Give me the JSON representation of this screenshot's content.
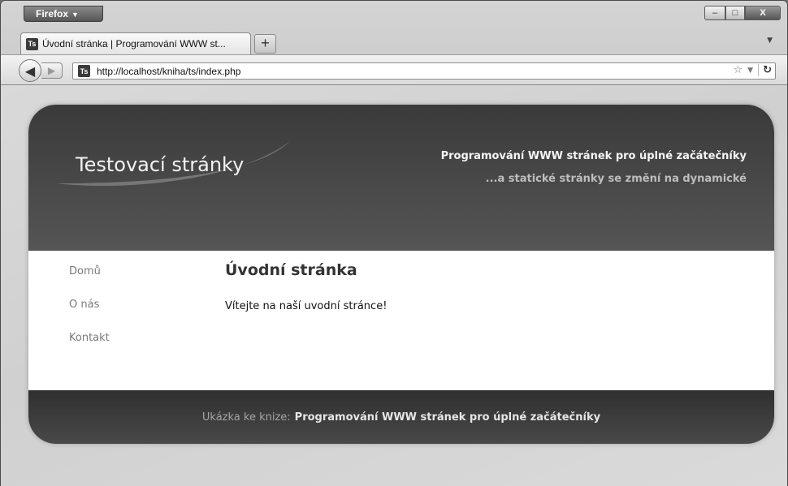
{
  "browser": {
    "menu_button": "Firefox",
    "window_controls": {
      "minimize": "–",
      "maximize": "□",
      "close": "X"
    },
    "tab": {
      "favicon": "Ts",
      "title": "Úvodní stránka | Programování WWW st..."
    },
    "new_tab": "+",
    "address": "http://localhost/kniha/ts/index.php",
    "icons": {
      "back": "arrow-left-icon",
      "forward": "arrow-right-icon",
      "bookmark": "star-icon",
      "dropdown": "chevron-down-icon",
      "reload": "reload-icon"
    }
  },
  "site": {
    "logo": "Testovací stránky",
    "header_title": "Programování WWW stránek pro úplné začátečníky",
    "header_subtitle": "...a statické stránky se změní na dynamické",
    "nav": [
      {
        "label": "Domů"
      },
      {
        "label": "O nás"
      },
      {
        "label": "Kontakt"
      }
    ],
    "heading": "Úvodní stránka",
    "body_text": "Vítejte na naší uvodní stránce!",
    "footer_prefix": "Ukázka ke knize:",
    "footer_link": "Programování WWW stránek pro úplné začátečníky"
  },
  "colors": {
    "header_bg": "#3a3a3a",
    "footer_bg": "#2f2f2f",
    "nav_text": "#7a7a7a",
    "heading_text": "#333333"
  }
}
